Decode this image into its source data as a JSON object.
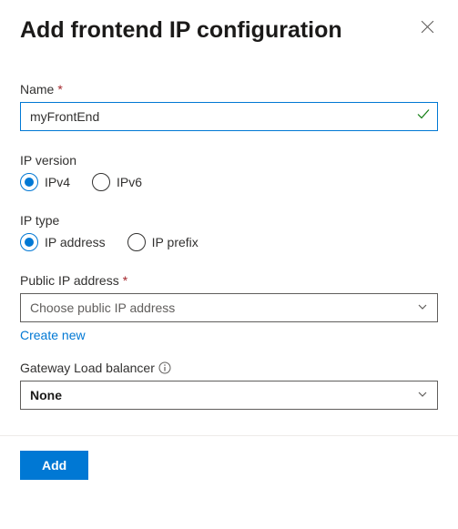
{
  "header": {
    "title": "Add frontend IP configuration"
  },
  "fields": {
    "name": {
      "label": "Name",
      "required_mark": "*",
      "value": "myFrontEnd"
    },
    "ip_version": {
      "label": "IP version",
      "options": {
        "ipv4": "IPv4",
        "ipv6": "IPv6"
      },
      "selected": "ipv4"
    },
    "ip_type": {
      "label": "IP type",
      "options": {
        "address": "IP address",
        "prefix": "IP prefix"
      },
      "selected": "address"
    },
    "public_ip": {
      "label": "Public IP address",
      "required_mark": "*",
      "placeholder": "Choose public IP address",
      "create_new": "Create new"
    },
    "gateway_lb": {
      "label": "Gateway Load balancer",
      "value": "None"
    }
  },
  "footer": {
    "add": "Add"
  }
}
